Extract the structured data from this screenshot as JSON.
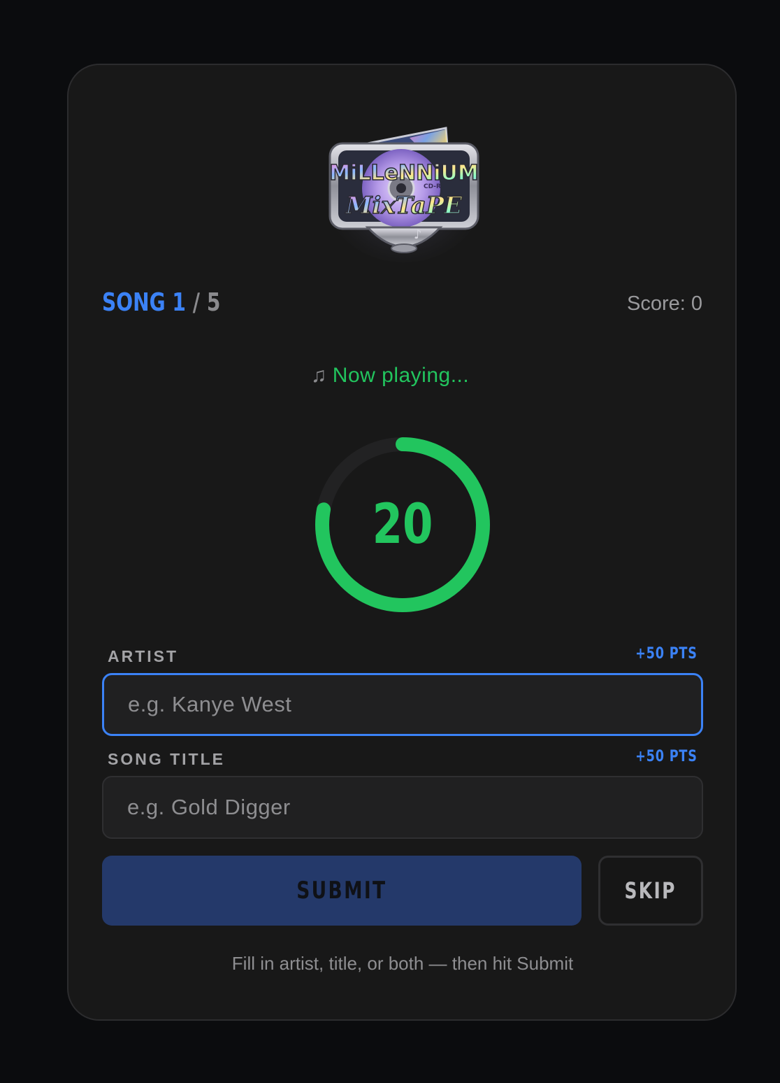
{
  "header": {
    "logo_text_line1": "MiLLeNNiUM",
    "logo_text_line2": "MixTaPE",
    "logo_disc_label": "CD-R"
  },
  "status": {
    "song_label": "SONG",
    "song_current": "1",
    "song_separator": "/",
    "song_total": "5",
    "score_text": "Score: 0",
    "now_playing_icon": "♫",
    "now_playing_text": "Now playing..."
  },
  "timer": {
    "value": "20",
    "remaining_fraction": 0.78
  },
  "form": {
    "artist": {
      "label": "ARTIST",
      "points": "+50 PTS",
      "value": "",
      "placeholder": "e.g. Kanye West"
    },
    "song_title": {
      "label": "SONG TITLE",
      "points": "+50 PTS",
      "value": "",
      "placeholder": "e.g. Gold Digger"
    },
    "submit_label": "SUBMIT",
    "skip_label": "SKIP",
    "hint": "Fill in artist, title, or both — then hit Submit"
  },
  "colors": {
    "accent_blue": "#3b82f6",
    "accent_green": "#22c55e",
    "card_bg": "#181818",
    "page_bg": "#0b0c0e"
  }
}
